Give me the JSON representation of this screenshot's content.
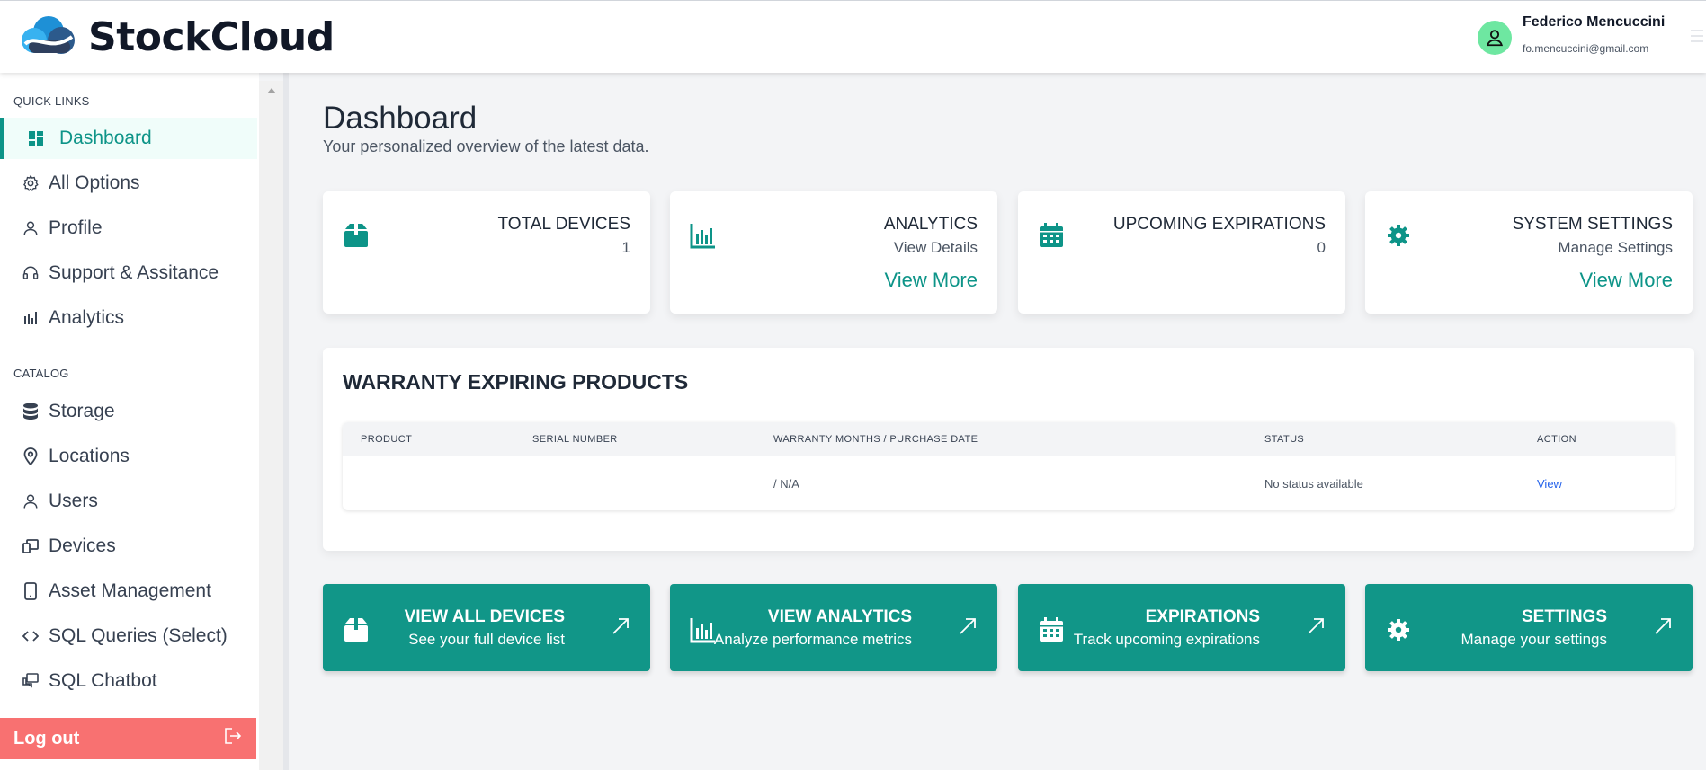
{
  "header": {
    "brand": "StockCloud",
    "user_name": "Federico Mencuccini",
    "user_email": "fo.mencuccini@gmail.com"
  },
  "sidebar": {
    "sections": [
      {
        "title": "QUICK LINKS",
        "items": [
          {
            "label": "Dashboard",
            "icon": "dashboard-icon",
            "active": true
          },
          {
            "label": "All Options",
            "icon": "gear-icon"
          },
          {
            "label": "Profile",
            "icon": "user-icon"
          },
          {
            "label": "Support & Assitance",
            "icon": "headset-icon"
          },
          {
            "label": "Analytics",
            "icon": "bar-chart-icon"
          }
        ]
      },
      {
        "title": "CATALOG",
        "items": [
          {
            "label": "Storage",
            "icon": "database-icon"
          },
          {
            "label": "Locations",
            "icon": "map-pin-icon"
          },
          {
            "label": "Users",
            "icon": "user-icon"
          },
          {
            "label": "Devices",
            "icon": "devices-icon"
          },
          {
            "label": "Asset Management",
            "icon": "mobile-icon"
          },
          {
            "label": "SQL Queries (Select)",
            "icon": "code-icon"
          },
          {
            "label": "SQL Chatbot",
            "icon": "chat-icon"
          }
        ]
      }
    ],
    "logout_label": "Log out"
  },
  "main": {
    "title": "Dashboard",
    "subtitle": "Your personalized overview of the latest data.",
    "cards": [
      {
        "title": "TOTAL DEVICES",
        "sub": "1",
        "link": "",
        "icon": "box-icon"
      },
      {
        "title": "ANALYTICS",
        "sub": "View Details",
        "link": "View More",
        "icon": "bar-chart-icon"
      },
      {
        "title": "UPCOMING EXPIRATIONS",
        "sub": "0",
        "link": "",
        "icon": "calendar-icon"
      },
      {
        "title": "SYSTEM SETTINGS",
        "sub": "Manage Settings",
        "link": "View More",
        "icon": "gear-icon"
      }
    ],
    "warranty": {
      "title": "WARRANTY EXPIRING PRODUCTS",
      "columns": [
        "PRODUCT",
        "SERIAL NUMBER",
        "WARRANTY MONTHS / PURCHASE DATE",
        "STATUS",
        "ACTION"
      ],
      "rows": [
        {
          "product": "",
          "serial": "",
          "warranty": "/ N/A",
          "status": "No status available",
          "action": "View"
        }
      ]
    },
    "quick_actions": [
      {
        "title": "VIEW ALL DEVICES",
        "sub": "See your full device list",
        "icon": "box-icon"
      },
      {
        "title": "VIEW ANALYTICS",
        "sub": "Analyze performance metrics",
        "icon": "bar-chart-icon"
      },
      {
        "title": "EXPIRATIONS",
        "sub": "Track upcoming expirations",
        "icon": "calendar-icon"
      },
      {
        "title": "SETTINGS",
        "sub": "Manage your settings",
        "icon": "gear-icon"
      }
    ],
    "colors": {
      "accent": "#0d9488",
      "button": "#119688",
      "logout": "#f87171",
      "link": "#2563eb"
    }
  }
}
